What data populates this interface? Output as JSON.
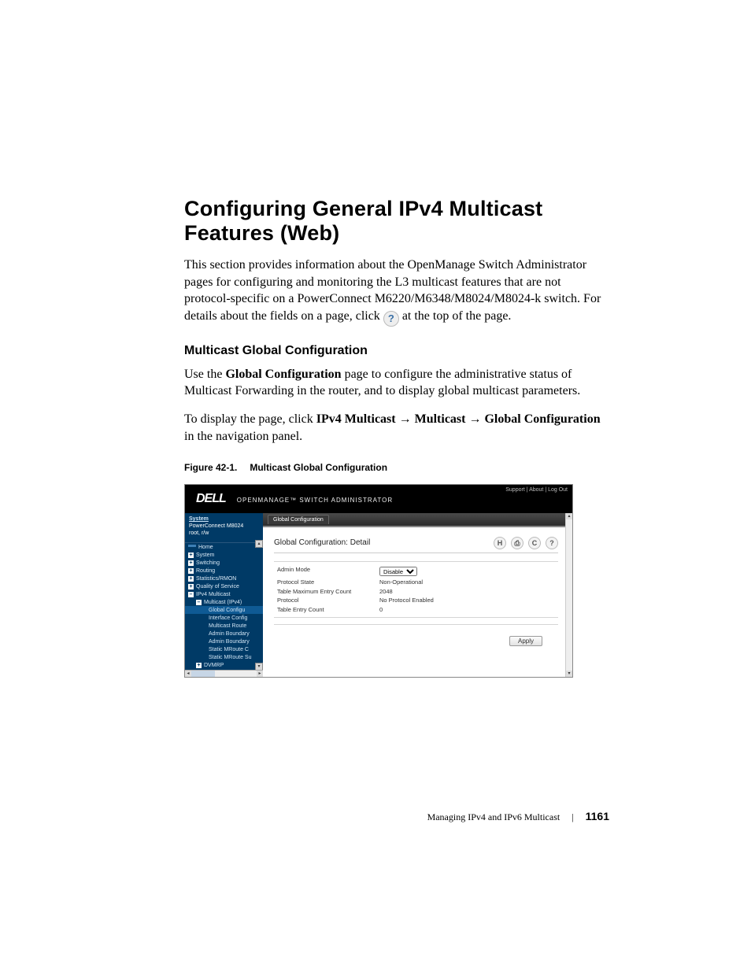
{
  "title": "Configuring General IPv4 Multicast Features (Web)",
  "intro_part1": "This section provides information about the OpenManage Switch Administrator pages for configuring and monitoring the L3 multicast features that are not protocol-specific on a PowerConnect M6220/M6348/M8024/M8024-k switch. For details about the fields on a page, click ",
  "intro_part2": " at the top of the page.",
  "help_glyph": "?",
  "subheading": "Multicast Global Configuration",
  "para2a": "Use the ",
  "para2b": "Global Configuration",
  "para2c": " page to configure the administrative status of Multicast Forwarding in the router, and to display global multicast parameters.",
  "para3a": "To display the page, click ",
  "para3b": "IPv4 Multicast",
  "para3c": "Multicast",
  "para3d": "Global Configuration",
  "para3e": " in the navigation panel.",
  "arrow": " → ",
  "figcap_num": "Figure 42-1.",
  "figcap_title": "Multicast Global Configuration",
  "shot": {
    "toplinks": "Support  |  About  |  Log Out",
    "logo": "DELL",
    "appname": "OPENMANAGE™  SWITCH  ADMINISTRATOR",
    "sidebar": {
      "system": "System",
      "device": "PowerConnect M8024",
      "user": "root, r/w",
      "items": [
        "Home",
        "System",
        "Switching",
        "Routing",
        "Statistics/RMON",
        "Quality of Service",
        "IPv4 Multicast"
      ],
      "sub1": "Multicast (IPv4)",
      "sub2": [
        "Global Configu",
        "Interface Config",
        "Multicast Route",
        "Admin Boundary",
        "Admin Boundary",
        "Static MRoute C",
        "Static MRoute Su"
      ],
      "sub3": "DVMRP"
    },
    "tab": "Global Configuration",
    "panel_title": "Global Configuration: Detail",
    "icons": {
      "save": "H",
      "print": "⎙",
      "refresh": "C",
      "help": "?"
    },
    "rows": [
      {
        "label": "Admin Mode",
        "value": "Disable",
        "type": "select"
      },
      {
        "label": "Protocol State",
        "value": "Non-Operational",
        "type": "text"
      },
      {
        "label": "Table Maximum Entry Count",
        "value": "2048",
        "type": "text"
      },
      {
        "label": "Protocol",
        "value": "No Protocol Enabled",
        "type": "text"
      },
      {
        "label": "Table Entry Count",
        "value": "0",
        "type": "text"
      }
    ],
    "apply": "Apply"
  },
  "footer": {
    "chapter": "Managing IPv4 and IPv6 Multicast",
    "page": "1161"
  }
}
